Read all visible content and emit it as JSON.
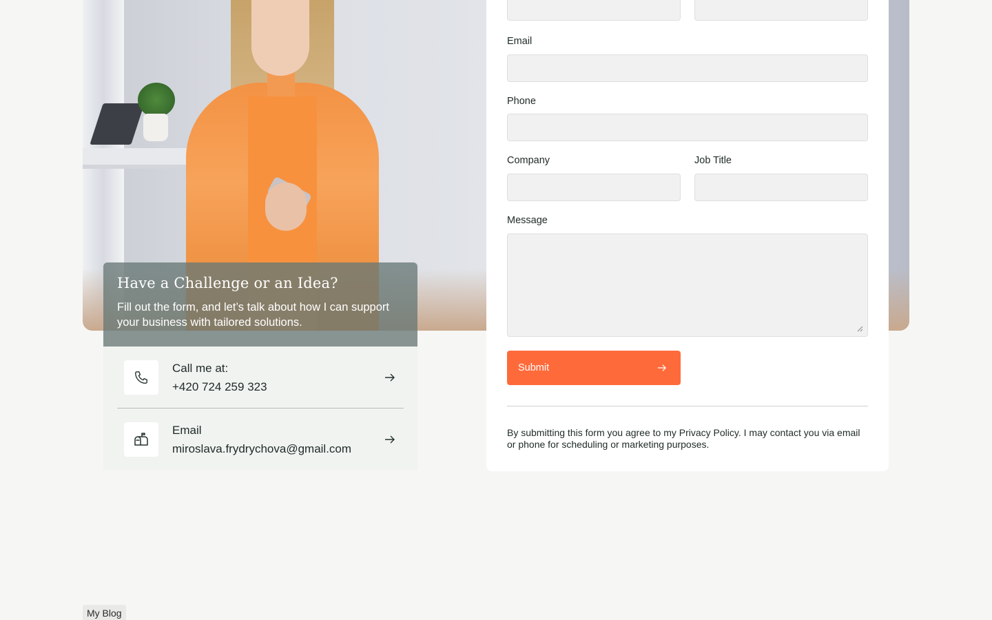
{
  "challenge": {
    "title": "Have a Challenge or an Idea?",
    "text": "Fill out the form, and let’s talk about how I can support your business with tailored solutions."
  },
  "contacts": {
    "phone": {
      "label": "Call me at:",
      "value": "+420 724 259 323",
      "icon": "phone-icon"
    },
    "email": {
      "label": "Email",
      "value": "miroslava.frydrychova@gmail.com",
      "icon": "mailbox-icon"
    }
  },
  "form": {
    "email_label": "Email",
    "phone_label": "Phone",
    "company_label": "Company",
    "job_title_label": "Job Title",
    "message_label": "Message",
    "submit_label": "Submit",
    "legal": "By submitting this form you agree to my Privacy Policy. I may contact you via email or phone for scheduling or marketing purposes."
  },
  "footer": {
    "blog_label": "My Blog"
  },
  "colors": {
    "accent": "#ff6a3a",
    "card_overlay": "#687876",
    "background": "#f6f6f5"
  }
}
